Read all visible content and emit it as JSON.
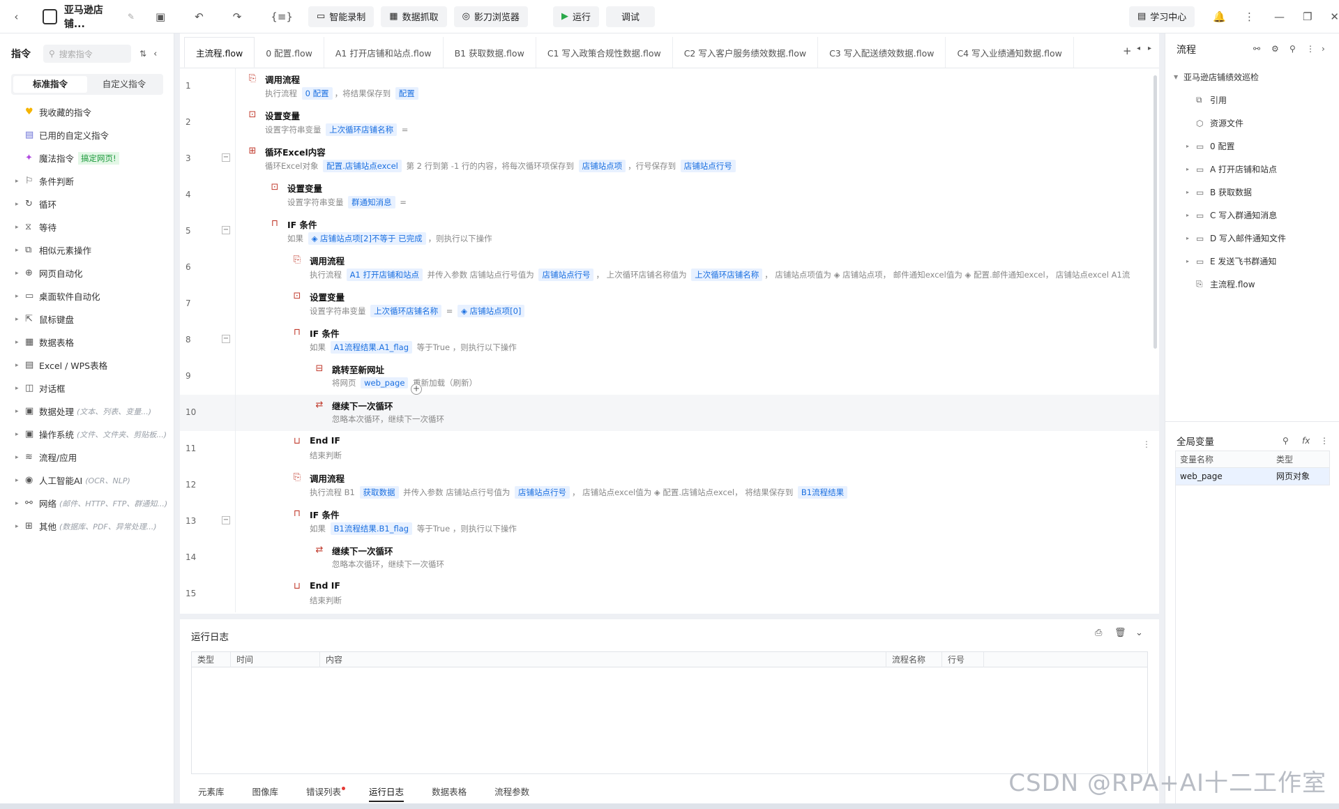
{
  "app": {
    "title": "亚马逊店铺...",
    "watermark": "CSDN @RPA+AI十二工作室"
  },
  "toolbar": {
    "smart_record": "智能录制",
    "data_capture": "数据抓取",
    "browser": "影刀浏览器",
    "run": "运行",
    "debug": "调试",
    "learning_center": "学习中心"
  },
  "left": {
    "header": "指令",
    "search_placeholder": "搜索指令",
    "tab_standard": "标准指令",
    "tab_custom": "自定义指令",
    "fav": "我收藏的指令",
    "used_custom": "已用的自定义指令",
    "magic": "魔法指令",
    "magic_badge": "搞定网页!",
    "groups": [
      {
        "label": "条件判断",
        "hint": ""
      },
      {
        "label": "循环",
        "hint": ""
      },
      {
        "label": "等待",
        "hint": ""
      },
      {
        "label": "相似元素操作",
        "hint": ""
      },
      {
        "label": "网页自动化",
        "hint": ""
      },
      {
        "label": "桌面软件自动化",
        "hint": ""
      },
      {
        "label": "鼠标键盘",
        "hint": ""
      },
      {
        "label": "数据表格",
        "hint": ""
      },
      {
        "label": "Excel / WPS表格",
        "hint": ""
      },
      {
        "label": "对话框",
        "hint": ""
      },
      {
        "label": "数据处理",
        "hint": "(文本、列表、变量...)"
      },
      {
        "label": "操作系统",
        "hint": "(文件、文件夹、剪贴板...)"
      },
      {
        "label": "流程/应用",
        "hint": ""
      },
      {
        "label": "人工智能AI",
        "hint": "(OCR、NLP)"
      },
      {
        "label": "网络",
        "hint": "(邮件、HTTP、FTP、群通知...)"
      },
      {
        "label": "其他",
        "hint": "(数据库、PDF、异常处理...)"
      }
    ]
  },
  "tabs": [
    "主流程.flow",
    "0 配置.flow",
    "A1 打开店铺和站点.flow",
    "B1 获取数据.flow",
    "C1 写入政策合规性数据.flow",
    "C2 写入客户服务绩效数据.flow",
    "C3 写入配送绩效数据.flow",
    "C4 写入业绩通知数据.flow"
  ],
  "steps": [
    {
      "n": "1",
      "title": "调用流程",
      "d1": "执行流程 ",
      "t1": "0 配置",
      "d2": "，将结果保存到 ",
      "t2": "配置"
    },
    {
      "n": "2",
      "title": "设置变量",
      "d1": "设置字符串变量 ",
      "t1": "上次循环店铺名称",
      "d2": " ="
    },
    {
      "n": "3",
      "title": "循环Excel内容",
      "d1": "循环Excel对象 ",
      "t1": "配置.店铺站点excel",
      "d2": " 第 2 行到第 -1 行的内容，将每次循环项保存到 ",
      "t2": "店铺站点项",
      "d3": "，行号保存到 ",
      "t3": "店铺站点行号"
    },
    {
      "n": "4",
      "title": "设置变量",
      "d1": "设置字符串变量 ",
      "t1": "群通知消息",
      "d2": " ="
    },
    {
      "n": "5",
      "title": "IF 条件",
      "d1": "如果 ",
      "t1": "◈ 店铺站点项[2]不等于 已完成",
      "d2": "，则执行以下操作"
    },
    {
      "n": "6",
      "title": "调用流程",
      "d1": "执行流程 ",
      "t1": "A1 打开店铺和站点",
      "d2": " 并传入参数 店铺站点行号值为 ",
      "t2": "店铺站点行号",
      "d3": "， 上次循环店铺名称值为 ",
      "t3": "上次循环店铺名称",
      "d4": "， 店铺站点项值为 ◈ 店铺站点项， 邮件通知excel值为 ◈ 配置.邮件通知excel， 店铺站点excel  A1流"
    },
    {
      "n": "7",
      "title": "设置变量",
      "d1": "设置字符串变量 ",
      "t1": "上次循环店铺名称",
      "d2": " = ",
      "t2": "◈ 店铺站点项[0]"
    },
    {
      "n": "8",
      "title": "IF 条件",
      "d1": "如果 ",
      "t1": "A1流程结果.A1_flag",
      "d2": " 等于True ，则执行以下操作"
    },
    {
      "n": "9",
      "title": "跳转至新网址",
      "d1": "将网页 ",
      "t1": "web_page",
      "d2": " 重新加载（刷新）"
    },
    {
      "n": "10",
      "title": "继续下一次循环",
      "d1": "忽略本次循环，继续下一次循环"
    },
    {
      "n": "11",
      "title": "End IF",
      "d1": "结束判断"
    },
    {
      "n": "12",
      "title": "调用流程",
      "d1": "执行流程 B1 ",
      "t1": "获取数据",
      "d2": " 并传入参数 店铺站点行号值为 ",
      "t2": "店铺站点行号",
      "d3": "， 店铺站点excel值为 ◈ 配置.店铺站点excel， 将结果保存到 ",
      "t3": "B1流程结果"
    },
    {
      "n": "13",
      "title": "IF 条件",
      "d1": "如果 ",
      "t1": "B1流程结果.B1_flag",
      "d2": " 等于True ，则执行以下操作"
    },
    {
      "n": "14",
      "title": "继续下一次循环",
      "d1": "忽略本次循环，继续下一次循环"
    },
    {
      "n": "15",
      "title": "End IF",
      "d1": "结束判断"
    }
  ],
  "right": {
    "header": "流程",
    "root": "亚马逊店铺绩效巡检",
    "items": [
      "引用",
      "资源文件",
      "0 配置",
      "A 打开店铺和站点",
      "B 获取数据",
      "C 写入群通知消息",
      "D 写入邮件通知文件",
      "E 发送飞书群通知",
      "主流程.flow"
    ],
    "globals_header": "全局变量",
    "col_name": "变量名称",
    "col_type": "类型",
    "var_name": "web_page",
    "var_type": "网页对象"
  },
  "log": {
    "title": "运行日志",
    "cols": [
      "类型",
      "时间",
      "内容",
      "流程名称",
      "行号"
    ],
    "tabs": [
      "元素库",
      "图像库",
      "错误列表",
      "运行日志",
      "数据表格",
      "流程参数"
    ]
  }
}
